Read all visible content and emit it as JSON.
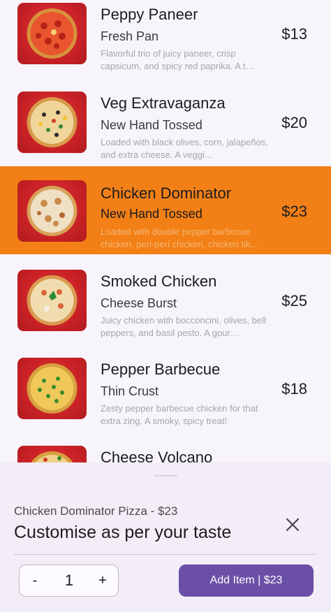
{
  "menu": {
    "items": [
      {
        "name": "Peppy Paneer",
        "crust": "Fresh Pan",
        "description": "Flavorful trio of juicy paneer, crisp capsicum, and spicy red paprika. A t…",
        "price": "$13"
      },
      {
        "name": "Veg Extravaganza",
        "crust": "New Hand Tossed",
        "description": "Loaded with black olives, corn, jalapeños, and extra cheese. A veggi…",
        "price": "$20"
      },
      {
        "name": "Chicken Dominator",
        "crust": "New Hand Tossed",
        "description": "Loaded with double pepper barbecue chicken, peri-peri chicken, chicken tik…",
        "price": "$23"
      },
      {
        "name": "Smoked Chicken",
        "crust": "Cheese Burst",
        "description": "Juicy chicken with bocconcini, olives, bell peppers, and basil pesto. A gour…",
        "price": "$25"
      },
      {
        "name": "Pepper Barbecue",
        "crust": "Thin Crust",
        "description": "Zesty pepper barbecue chicken for that extra zing. A smoky, spicy treat!",
        "price": "$18"
      },
      {
        "name": "Cheese Volcano",
        "crust": "",
        "description": "",
        "price": ""
      }
    ]
  },
  "sheet": {
    "subtitle": "Chicken Dominator Pizza - $23",
    "title": "Customise as per your taste",
    "close_icon": "close-icon",
    "quantity": "1",
    "minus_label": "-",
    "plus_label": "+",
    "add_button_label": "Add Item | $23"
  },
  "colors": {
    "selected_row": "#f28016",
    "accent_button": "#6b4fa6",
    "background": "#f8f4fc",
    "sheet_background": "#f3edf7"
  }
}
